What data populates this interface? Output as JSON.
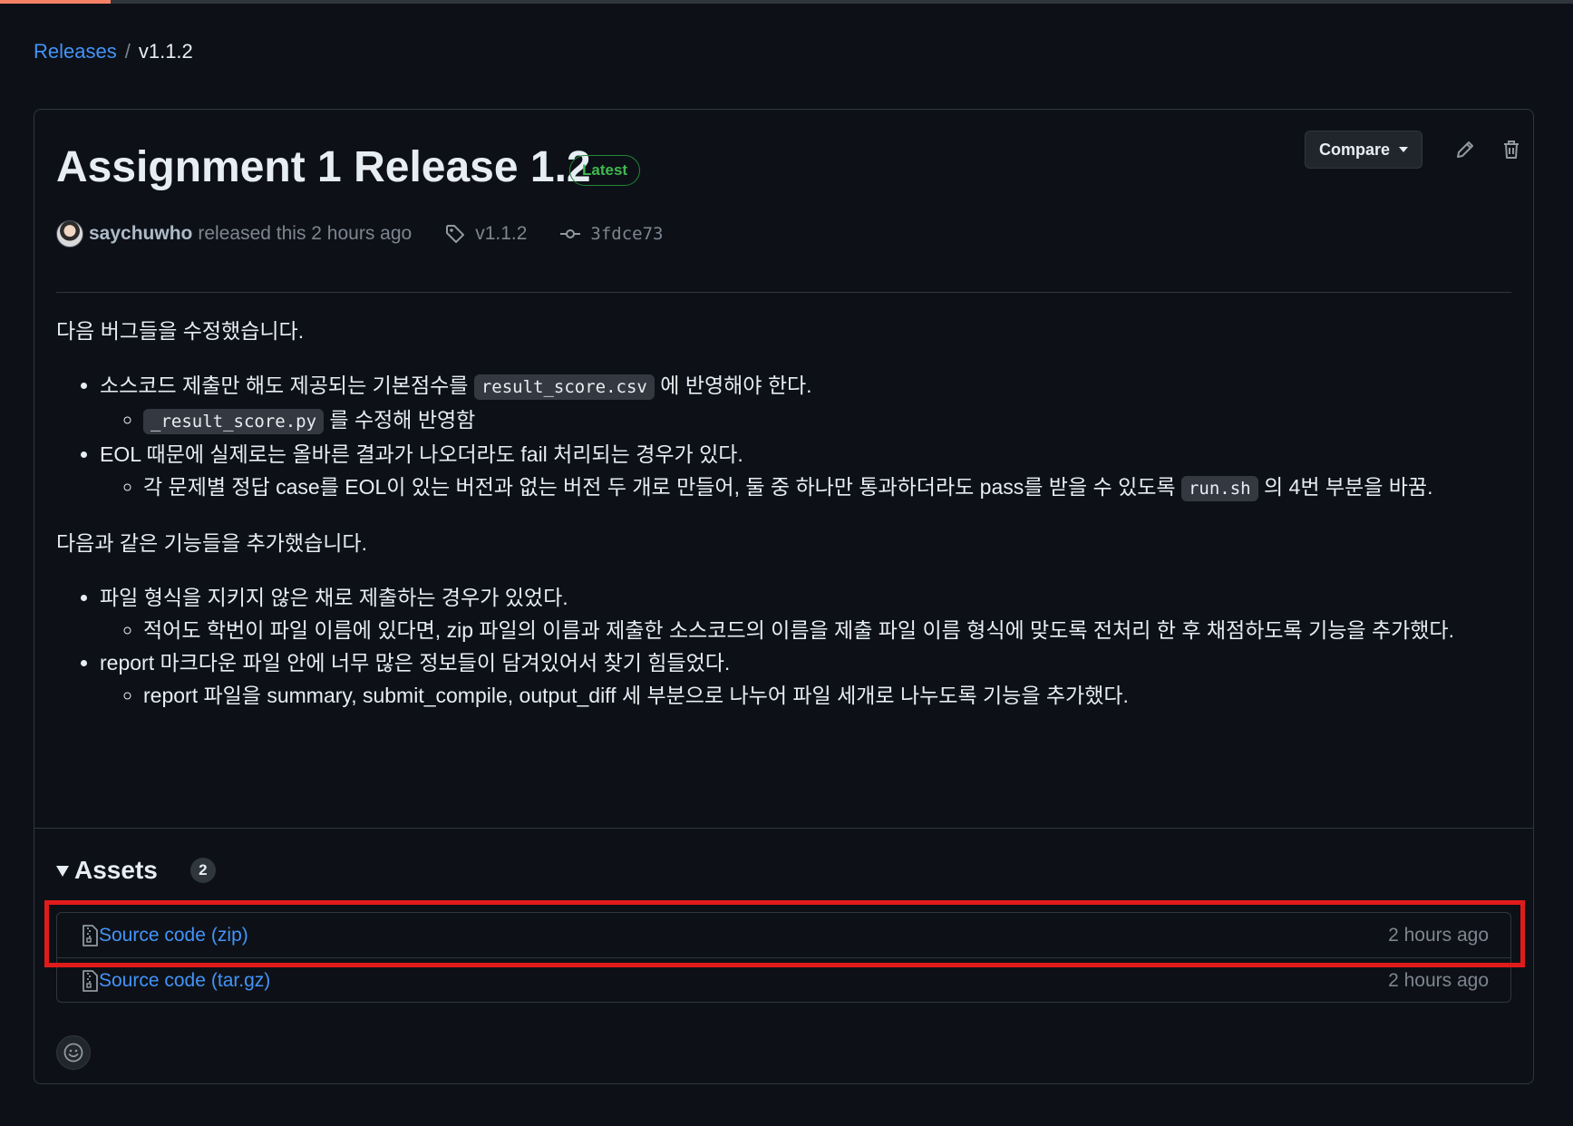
{
  "breadcrumb": {
    "parent": "Releases",
    "separator": "/",
    "current": "v1.1.2"
  },
  "release": {
    "title": "Assignment 1 Release 1.2",
    "badge": "Latest",
    "compare_label": "Compare",
    "author": "saychuwho",
    "released_text": "released this 2 hours ago",
    "tag": "v1.1.2",
    "commit": "3fdce73"
  },
  "notes": {
    "fixes_heading": "다음 버그들을 수정했습니다.",
    "fix1": {
      "before": "소스코드 제출만 해도 제공되는 기본점수를 ",
      "code": "result_score.csv",
      "after": " 에 반영해야 한다.",
      "sub": {
        "code": "_result_score.py",
        "after": " 를 수정해 반영함"
      }
    },
    "fix2": {
      "text": "EOL 때문에 실제로는 올바른 결과가 나오더라도 fail 처리되는 경우가 있다.",
      "sub": {
        "before": "각 문제별 정답 case를 EOL이 있는 버전과 없는 버전 두 개로 만들어, 둘 중 하나만 통과하더라도 pass를 받을 수 있도록 ",
        "code": "run.sh",
        "after": " 의 4번 부분을 바꿈."
      }
    },
    "features_heading": "다음과 같은 기능들을 추가했습니다.",
    "feature1": {
      "text": "파일 형식을 지키지 않은 채로 제출하는 경우가 있었다.",
      "sub": "적어도 학번이 파일 이름에 있다면, zip 파일의 이름과 제출한 소스코드의 이름을 제출 파일 이름 형식에 맞도록 전처리 한 후 채점하도록 기능을 추가했다."
    },
    "feature2": {
      "text": "report 마크다운 파일 안에 너무 많은 정보들이 담겨있어서 찾기 힘들었다.",
      "sub": "report 파일을 summary, submit_compile, output_diff 세 부분으로 나누어 파일 세개로 나누도록 기능을 추가했다."
    }
  },
  "assets": {
    "title": "Assets",
    "count": "2",
    "items": [
      {
        "label": "Source code",
        "suffix": "(zip)",
        "time": "2 hours ago"
      },
      {
        "label": "Source code",
        "suffix": "(tar.gz)",
        "time": "2 hours ago"
      }
    ]
  },
  "colors": {
    "background": "#0d1117",
    "link": "#4493f8",
    "badge_green": "#3fb950",
    "highlight": "#e01b1b"
  },
  "icons": {
    "tag": "tag-icon",
    "commit": "commit-icon",
    "edit": "pencil-icon",
    "delete": "trash-icon",
    "file": "file-zip-icon",
    "reaction": "smiley-icon"
  }
}
